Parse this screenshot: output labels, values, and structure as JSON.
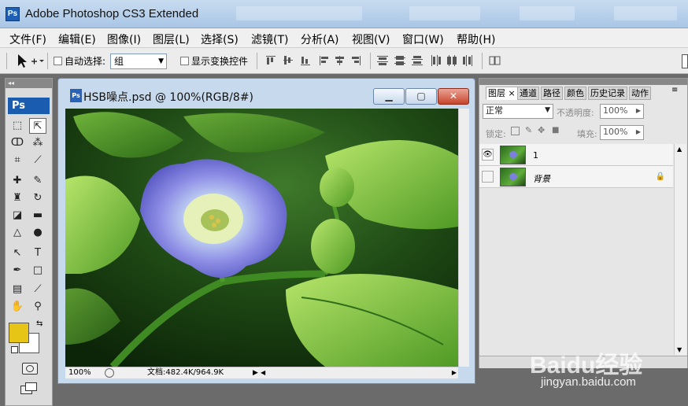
{
  "app": {
    "title": "Adobe Photoshop CS3 Extended",
    "badge": "Ps"
  },
  "menu": [
    "文件(F)",
    "编辑(E)",
    "图像(I)",
    "图层(L)",
    "选择(S)",
    "滤镜(T)",
    "分析(A)",
    "视图(V)",
    "窗口(W)",
    "帮助(H)"
  ],
  "options": {
    "auto_select_label": "自动选择:",
    "auto_select_value": "组",
    "show_transform_label": "显示变换控件"
  },
  "tools": {
    "logo": "Ps"
  },
  "document": {
    "title": "HSB噪点.psd @ 100%(RGB/8#)",
    "icon": "Ps",
    "zoom": "100%",
    "doc_size": "文档:482.4K/964.9K"
  },
  "layers_panel": {
    "tabs": [
      "图层",
      "通道",
      "路径",
      "颜色",
      "历史记录",
      "动作"
    ],
    "blend_mode": "正常",
    "opacity_label": "不透明度:",
    "opacity_value": "100%",
    "lock_label": "锁定:",
    "fill_label": "填充:",
    "fill_value": "100%",
    "layers": [
      {
        "name": "1",
        "visible": true,
        "locked": false
      },
      {
        "name": "背景",
        "visible": false,
        "locked": true
      }
    ]
  },
  "watermark": {
    "logo": "Baidu经验",
    "url": "jingyan.baidu.com"
  },
  "colors": {
    "foreground": "#e7c517",
    "background": "#ffffff",
    "accent": "#1a5cb0"
  }
}
